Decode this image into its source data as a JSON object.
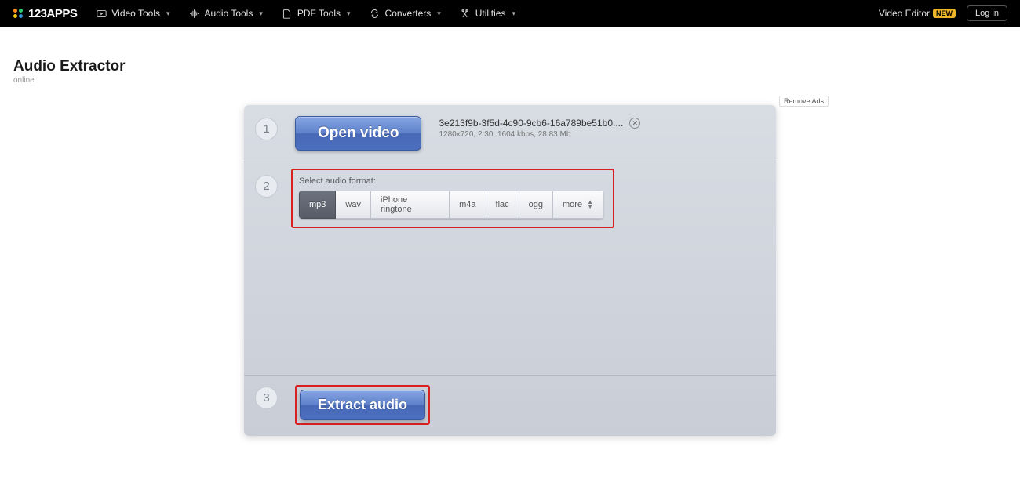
{
  "nav": {
    "logo_text": "123APPS",
    "items": [
      {
        "label": "Video Tools",
        "icon": "play-icon"
      },
      {
        "label": "Audio Tools",
        "icon": "audio-icon"
      },
      {
        "label": "PDF Tools",
        "icon": "pdf-icon"
      },
      {
        "label": "Converters",
        "icon": "converter-icon"
      },
      {
        "label": "Utilities",
        "icon": "utilities-icon"
      }
    ],
    "video_editor": "Video Editor",
    "new_badge": "NEW",
    "login": "Log in"
  },
  "page": {
    "title": "Audio Extractor",
    "subtitle": "online"
  },
  "panel": {
    "remove_ads": "Remove Ads",
    "step1": {
      "num": "1",
      "button": "Open video",
      "filename": "3e213f9b-3f5d-4c90-9cb6-16a789be51b0....",
      "meta": "1280x720, 2:30, 1604 kbps, 28.83 Mb"
    },
    "step2": {
      "num": "2",
      "label": "Select audio format:",
      "formats": [
        "mp3",
        "wav",
        "iPhone ringtone",
        "m4a",
        "flac",
        "ogg",
        "more"
      ],
      "active_index": 0
    },
    "step3": {
      "num": "3",
      "button": "Extract audio"
    }
  }
}
